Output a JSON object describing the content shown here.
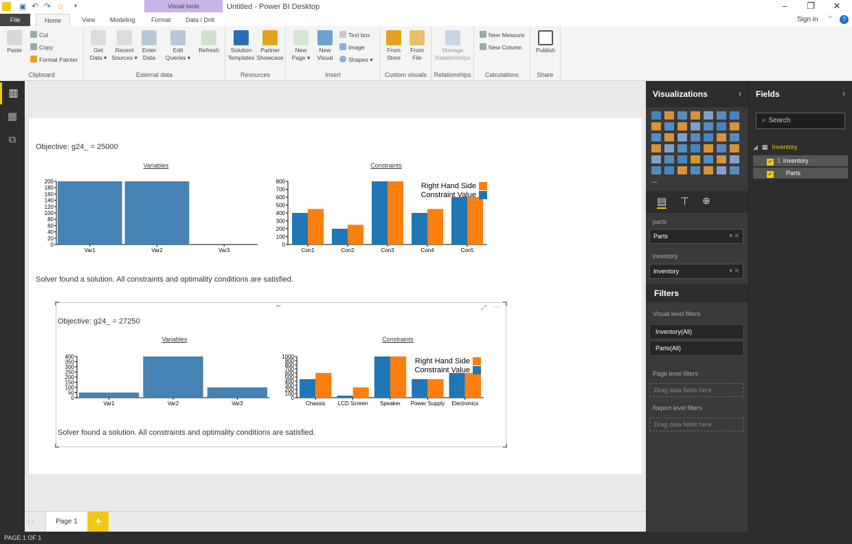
{
  "window": {
    "title": "Untitled - Power BI Desktop",
    "context_tab": "Visual tools",
    "sign_in": "Sign in"
  },
  "tabs": [
    "File",
    "Home",
    "View",
    "Modeling",
    "Format",
    "Data / Drill"
  ],
  "ribbon": {
    "clipboard": {
      "label": "Clipboard",
      "paste": "Paste",
      "cut": "Cut",
      "copy": "Copy",
      "format_painter": "Format Painter"
    },
    "external_data": {
      "label": "External data",
      "get_data": "Get\nData ▾",
      "recent_sources": "Recent\nSources ▾",
      "enter_data": "Enter\nData",
      "edit_queries": "Edit\nQueries ▾",
      "refresh": "Refresh"
    },
    "resources": {
      "label": "Resources",
      "solution_templates": "Solution\nTemplates",
      "partner_showcase": "Partner\nShowcase"
    },
    "insert": {
      "label": "Insert",
      "new_page": "New\nPage ▾",
      "new_visual": "New\nVisual",
      "text_box": "Text box",
      "image": "Image",
      "shapes": "Shapes ▾"
    },
    "custom_visuals": {
      "label": "Custom visuals",
      "from_store": "From\nStore",
      "from_file": "From\nFile"
    },
    "relationships": {
      "label": "Relationships",
      "manage": "Manage\nRelationships"
    },
    "calculations": {
      "label": "Calculations",
      "new_measure": "New Measure",
      "new_column": "New Column"
    },
    "share": {
      "label": "Share",
      "publish": "Publish"
    }
  },
  "report": {
    "visual1": {
      "objective": "Objective: g24_ = 25000",
      "solver_message": "Solver found a solution. All constraints and optimality conditions are satisfied."
    },
    "visual2": {
      "objective": "Objective: g24_ = 27250",
      "solver_message": "Solver found a solution. All constraints and optimality conditions are satisfied."
    }
  },
  "chart_data": [
    {
      "type": "bar",
      "title": "Variables",
      "categories": [
        "Var1",
        "Var2",
        "Var3"
      ],
      "values": [
        200,
        200,
        0
      ],
      "ylim": [
        0,
        200
      ],
      "yticks": [
        0,
        20,
        40,
        60,
        80,
        100,
        120,
        140,
        160,
        180,
        200
      ],
      "colors": [
        "#4682b4"
      ]
    },
    {
      "type": "bar",
      "title": "Constraints",
      "categories": [
        "Con1",
        "Con2",
        "Con3",
        "Con4",
        "Con5"
      ],
      "series": [
        {
          "name": "Constraint Value",
          "values": [
            400,
            200,
            800,
            400,
            600
          ],
          "color": "#1f77b4"
        },
        {
          "name": "Right Hand Side",
          "values": [
            450,
            250,
            800,
            450,
            600
          ],
          "color": "#ff7f0e"
        }
      ],
      "ylim": [
        0,
        800
      ],
      "yticks": [
        0,
        100,
        200,
        300,
        400,
        500,
        600,
        700,
        800
      ],
      "legend": "top-right"
    },
    {
      "type": "bar",
      "title": "Variables",
      "categories": [
        "Var1",
        "Var2",
        "Var3"
      ],
      "values": [
        50,
        400,
        100
      ],
      "ylim": [
        0,
        400
      ],
      "yticks": [
        0,
        50,
        100,
        150,
        200,
        250,
        300,
        350,
        400
      ],
      "colors": [
        "#4682b4"
      ]
    },
    {
      "type": "bar",
      "title": "Constraints",
      "categories": [
        "Chassis",
        "LCD Screen",
        "Speaker",
        "Power Supply",
        "Electronics"
      ],
      "series": [
        {
          "name": "Constraint Value",
          "values": [
            450,
            50,
            1000,
            450,
            600
          ],
          "color": "#1f77b4"
        },
        {
          "name": "Right Hand Side",
          "values": [
            600,
            250,
            1000,
            450,
            600
          ],
          "color": "#ff7f0e"
        }
      ],
      "ylim": [
        0,
        1000
      ],
      "yticks": [
        0,
        100,
        200,
        300,
        400,
        500,
        600,
        700,
        800,
        900,
        1000
      ],
      "legend": "top-right"
    }
  ],
  "page_tabs": {
    "page1": "Page 1",
    "add": "+"
  },
  "status_bar": "PAGE 1 OF 1",
  "visualizations": {
    "header": "Visualizations",
    "well_parts_label": "parts",
    "well_parts_value": "Parts",
    "well_inventory_label": "inventory",
    "well_inventory_value": "Inventory",
    "more": "..."
  },
  "filters": {
    "header": "Filters",
    "visual_level": "Visual level filters",
    "filter1": "Inventory(All)",
    "filter2": "Parts(All)",
    "page_level": "Page level filters",
    "drag_page": "Drag data fields here",
    "report_level": "Report level filters",
    "drag_report": "Drag data fields here"
  },
  "fields": {
    "header": "Fields",
    "search_placeholder": "Search",
    "table": "Inventory",
    "items": [
      "Inventory",
      "Parts"
    ]
  }
}
